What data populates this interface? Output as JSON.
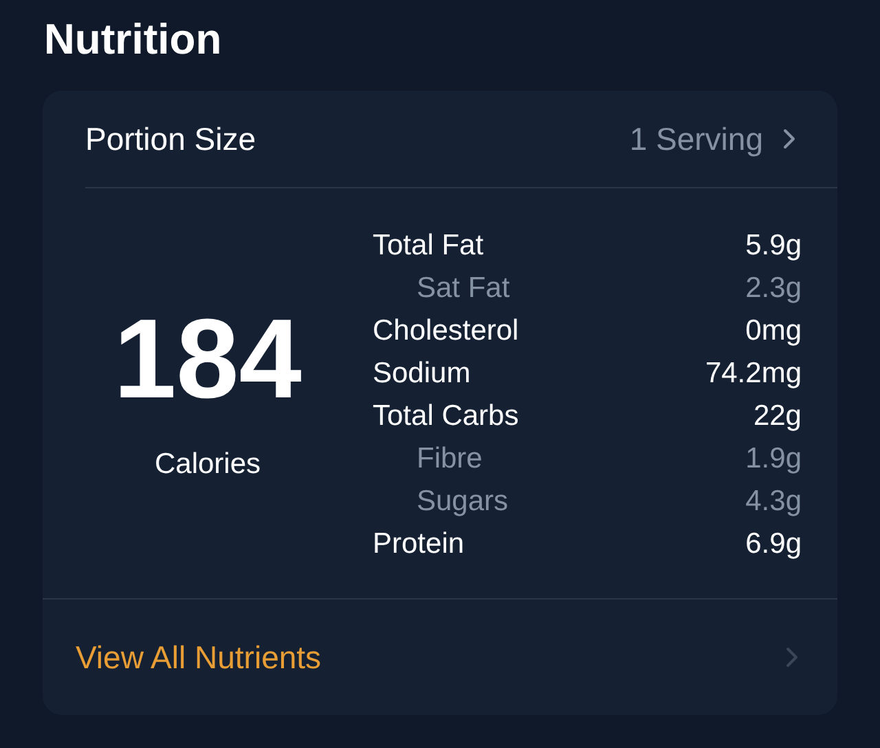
{
  "title": "Nutrition",
  "portion": {
    "label": "Portion Size",
    "value": "1 Serving"
  },
  "calories": {
    "value": "184",
    "label": "Calories"
  },
  "nutrients": [
    {
      "kind": "main",
      "name": "Total Fat",
      "amount": "5.9g"
    },
    {
      "kind": "sub",
      "name": "Sat Fat",
      "amount": "2.3g"
    },
    {
      "kind": "main",
      "name": "Cholesterol",
      "amount": "0mg"
    },
    {
      "kind": "main",
      "name": "Sodium",
      "amount": "74.2mg"
    },
    {
      "kind": "main",
      "name": "Total Carbs",
      "amount": "22g"
    },
    {
      "kind": "sub",
      "name": "Fibre",
      "amount": "1.9g"
    },
    {
      "kind": "sub",
      "name": "Sugars",
      "amount": "4.3g"
    },
    {
      "kind": "main",
      "name": "Protein",
      "amount": "6.9g"
    }
  ],
  "link": "View All Nutrients"
}
